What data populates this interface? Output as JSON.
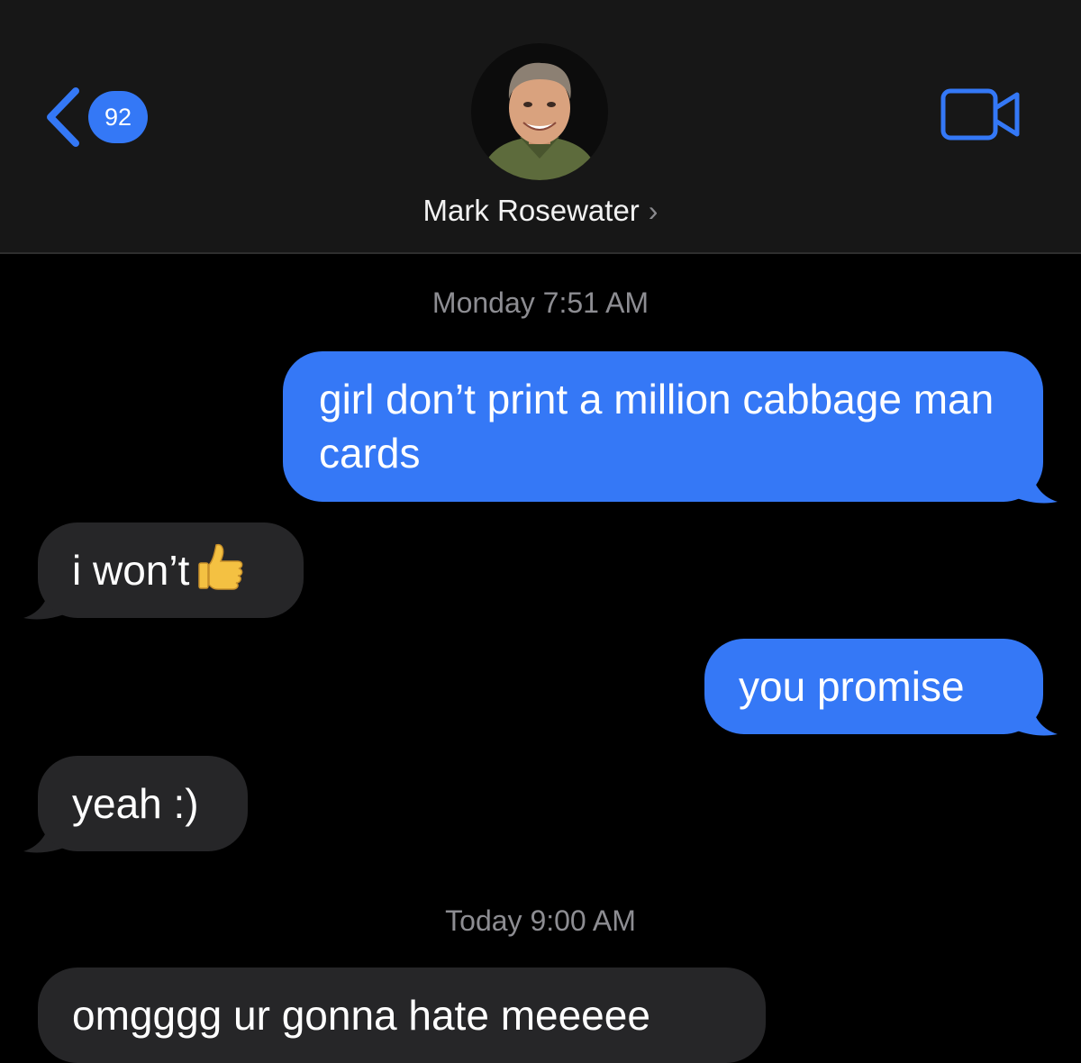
{
  "header": {
    "unread_count": "92",
    "contact_name": "Mark Rosewater",
    "contact_chevron": "›",
    "back_icon": "chevron-left-icon",
    "video_icon": "video-camera-icon"
  },
  "colors": {
    "accent": "#3478f6",
    "outgoing_bubble": "#3578f6",
    "incoming_bubble": "#262628",
    "header_bg": "#171717",
    "timestamp": "#8d8d92"
  },
  "timestamps": {
    "first": "Monday 7:51 AM",
    "second": "Today 9:00 AM"
  },
  "messages": [
    {
      "direction": "outgoing",
      "text": "girl don’t print a million cabbage man cards"
    },
    {
      "direction": "incoming",
      "text": "i won’t",
      "emoji": "thumbs-up-emoji"
    },
    {
      "direction": "outgoing",
      "text": "you promise"
    },
    {
      "direction": "incoming",
      "text": "yeah :)"
    },
    {
      "direction": "incoming",
      "text": "omgggg ur gonna hate meeeee"
    }
  ]
}
